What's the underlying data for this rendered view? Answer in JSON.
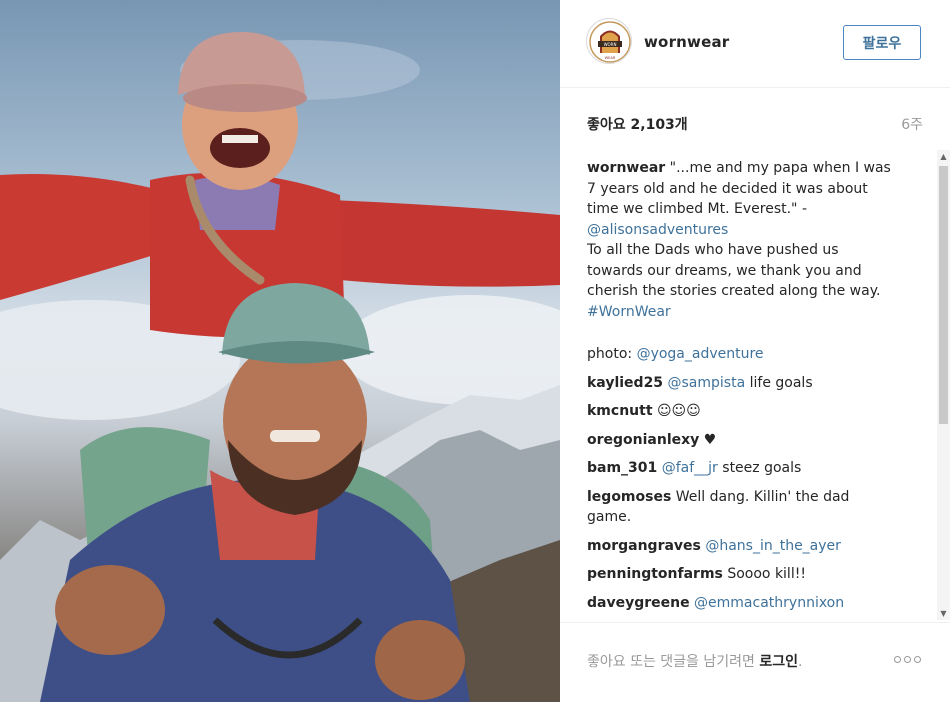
{
  "post": {
    "image_alt": "Father carrying his daughter on his shoulders in front of snowy mountains"
  },
  "header": {
    "avatar_logo_text": "WORN WEAR",
    "username": "wornwear",
    "follow_label": "팔로우"
  },
  "stats": {
    "likes": "좋아요 2,103개",
    "time": "6주"
  },
  "caption": {
    "username": "wornwear",
    "line1": "\"...me and my papa when I was",
    "line2": "7 years old and he decided it was about",
    "line3": "time we climbed Mt. Everest.\" -",
    "mention": "@alisonsadventures",
    "line4": "To all the Dads who have pushed us",
    "line5": "towards our dreams, we thank you and",
    "line6": "cherish the stories created along the way.",
    "hashtag": "#WornWear"
  },
  "comments": [
    {
      "username": "photo:",
      "mention": "@yoga_adventure",
      "text": ""
    },
    {
      "username": "kaylied25",
      "mention": "@sampista",
      "text": " life goals"
    },
    {
      "username": "kmcnutt",
      "mention": "",
      "text": " ☺☺☺"
    },
    {
      "username": "oregonianlexy",
      "mention": "",
      "text": " ♥"
    },
    {
      "username": "bam_301",
      "mention": "@faf__jr",
      "text": " steez goals"
    },
    {
      "username": "legomoses",
      "mention": "",
      "text": " Well dang. Killin' the dad",
      "text2": "game."
    },
    {
      "username": "morgangraves",
      "mention": "@hans_in_the_ayer",
      "text": ""
    },
    {
      "username": "penningtonfarms",
      "mention": "",
      "text": " Soooo kill!!"
    },
    {
      "username": "daveygreene",
      "mention": "@emmacathrynnixon",
      "text": ""
    }
  ],
  "footer": {
    "prompt": "좋아요 또는 댓글을 남기려면 ",
    "login_label": "로그인",
    "period": "."
  },
  "colors": {
    "link": "#3f729b",
    "follow_border": "#4a86c5",
    "muted": "#999999"
  }
}
